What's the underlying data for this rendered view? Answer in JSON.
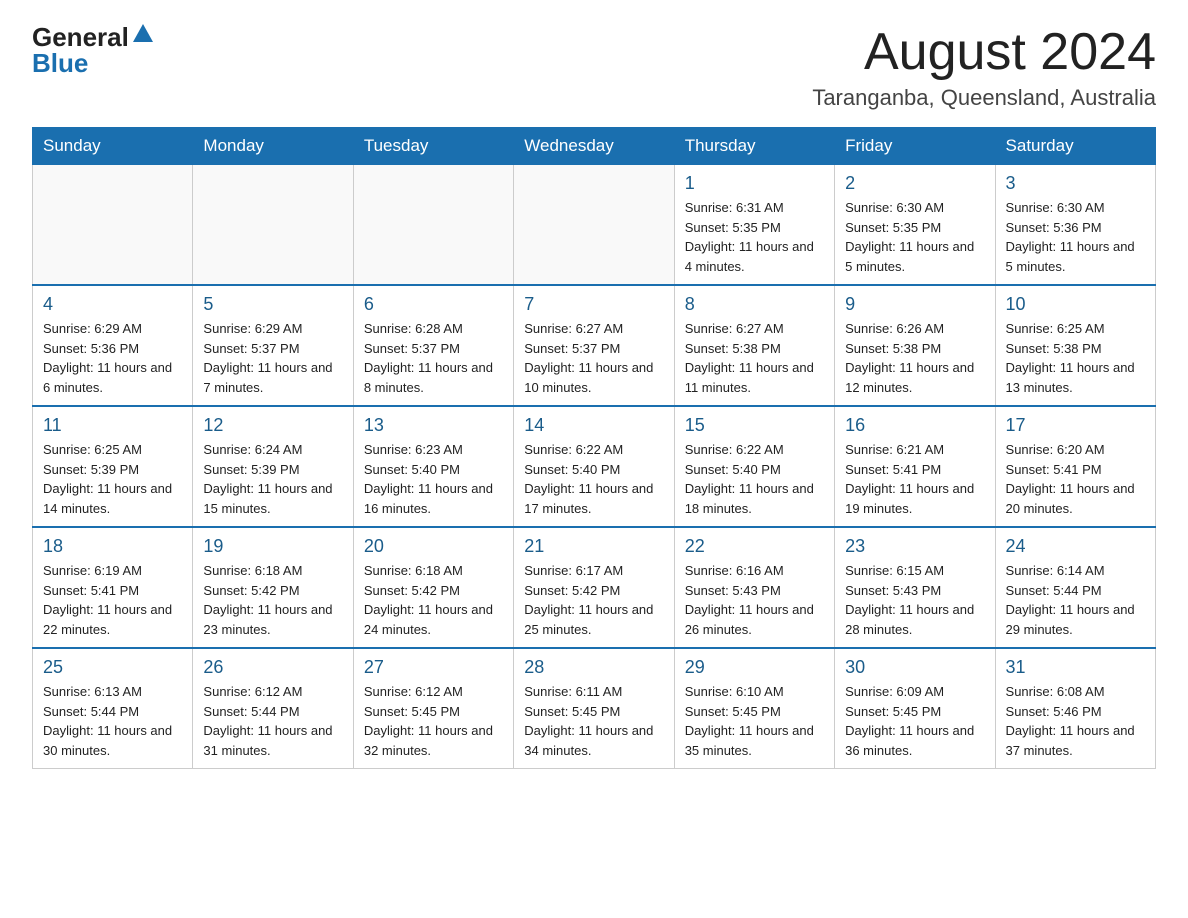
{
  "logo": {
    "text_general": "General",
    "text_blue": "Blue"
  },
  "title": "August 2024",
  "subtitle": "Taranganba, Queensland, Australia",
  "days_of_week": [
    "Sunday",
    "Monday",
    "Tuesday",
    "Wednesday",
    "Thursday",
    "Friday",
    "Saturday"
  ],
  "weeks": [
    [
      {
        "day": "",
        "info": ""
      },
      {
        "day": "",
        "info": ""
      },
      {
        "day": "",
        "info": ""
      },
      {
        "day": "",
        "info": ""
      },
      {
        "day": "1",
        "info": "Sunrise: 6:31 AM\nSunset: 5:35 PM\nDaylight: 11 hours and 4 minutes."
      },
      {
        "day": "2",
        "info": "Sunrise: 6:30 AM\nSunset: 5:35 PM\nDaylight: 11 hours and 5 minutes."
      },
      {
        "day": "3",
        "info": "Sunrise: 6:30 AM\nSunset: 5:36 PM\nDaylight: 11 hours and 5 minutes."
      }
    ],
    [
      {
        "day": "4",
        "info": "Sunrise: 6:29 AM\nSunset: 5:36 PM\nDaylight: 11 hours and 6 minutes."
      },
      {
        "day": "5",
        "info": "Sunrise: 6:29 AM\nSunset: 5:37 PM\nDaylight: 11 hours and 7 minutes."
      },
      {
        "day": "6",
        "info": "Sunrise: 6:28 AM\nSunset: 5:37 PM\nDaylight: 11 hours and 8 minutes."
      },
      {
        "day": "7",
        "info": "Sunrise: 6:27 AM\nSunset: 5:37 PM\nDaylight: 11 hours and 10 minutes."
      },
      {
        "day": "8",
        "info": "Sunrise: 6:27 AM\nSunset: 5:38 PM\nDaylight: 11 hours and 11 minutes."
      },
      {
        "day": "9",
        "info": "Sunrise: 6:26 AM\nSunset: 5:38 PM\nDaylight: 11 hours and 12 minutes."
      },
      {
        "day": "10",
        "info": "Sunrise: 6:25 AM\nSunset: 5:38 PM\nDaylight: 11 hours and 13 minutes."
      }
    ],
    [
      {
        "day": "11",
        "info": "Sunrise: 6:25 AM\nSunset: 5:39 PM\nDaylight: 11 hours and 14 minutes."
      },
      {
        "day": "12",
        "info": "Sunrise: 6:24 AM\nSunset: 5:39 PM\nDaylight: 11 hours and 15 minutes."
      },
      {
        "day": "13",
        "info": "Sunrise: 6:23 AM\nSunset: 5:40 PM\nDaylight: 11 hours and 16 minutes."
      },
      {
        "day": "14",
        "info": "Sunrise: 6:22 AM\nSunset: 5:40 PM\nDaylight: 11 hours and 17 minutes."
      },
      {
        "day": "15",
        "info": "Sunrise: 6:22 AM\nSunset: 5:40 PM\nDaylight: 11 hours and 18 minutes."
      },
      {
        "day": "16",
        "info": "Sunrise: 6:21 AM\nSunset: 5:41 PM\nDaylight: 11 hours and 19 minutes."
      },
      {
        "day": "17",
        "info": "Sunrise: 6:20 AM\nSunset: 5:41 PM\nDaylight: 11 hours and 20 minutes."
      }
    ],
    [
      {
        "day": "18",
        "info": "Sunrise: 6:19 AM\nSunset: 5:41 PM\nDaylight: 11 hours and 22 minutes."
      },
      {
        "day": "19",
        "info": "Sunrise: 6:18 AM\nSunset: 5:42 PM\nDaylight: 11 hours and 23 minutes."
      },
      {
        "day": "20",
        "info": "Sunrise: 6:18 AM\nSunset: 5:42 PM\nDaylight: 11 hours and 24 minutes."
      },
      {
        "day": "21",
        "info": "Sunrise: 6:17 AM\nSunset: 5:42 PM\nDaylight: 11 hours and 25 minutes."
      },
      {
        "day": "22",
        "info": "Sunrise: 6:16 AM\nSunset: 5:43 PM\nDaylight: 11 hours and 26 minutes."
      },
      {
        "day": "23",
        "info": "Sunrise: 6:15 AM\nSunset: 5:43 PM\nDaylight: 11 hours and 28 minutes."
      },
      {
        "day": "24",
        "info": "Sunrise: 6:14 AM\nSunset: 5:44 PM\nDaylight: 11 hours and 29 minutes."
      }
    ],
    [
      {
        "day": "25",
        "info": "Sunrise: 6:13 AM\nSunset: 5:44 PM\nDaylight: 11 hours and 30 minutes."
      },
      {
        "day": "26",
        "info": "Sunrise: 6:12 AM\nSunset: 5:44 PM\nDaylight: 11 hours and 31 minutes."
      },
      {
        "day": "27",
        "info": "Sunrise: 6:12 AM\nSunset: 5:45 PM\nDaylight: 11 hours and 32 minutes."
      },
      {
        "day": "28",
        "info": "Sunrise: 6:11 AM\nSunset: 5:45 PM\nDaylight: 11 hours and 34 minutes."
      },
      {
        "day": "29",
        "info": "Sunrise: 6:10 AM\nSunset: 5:45 PM\nDaylight: 11 hours and 35 minutes."
      },
      {
        "day": "30",
        "info": "Sunrise: 6:09 AM\nSunset: 5:45 PM\nDaylight: 11 hours and 36 minutes."
      },
      {
        "day": "31",
        "info": "Sunrise: 6:08 AM\nSunset: 5:46 PM\nDaylight: 11 hours and 37 minutes."
      }
    ]
  ]
}
